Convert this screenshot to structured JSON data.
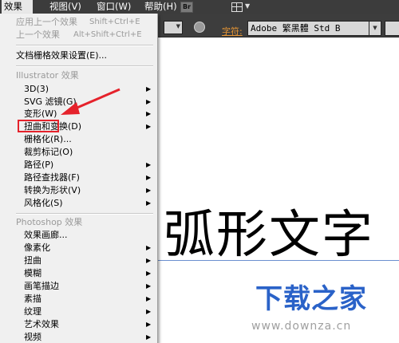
{
  "menubar": {
    "items": [
      {
        "label": "效果(C)",
        "active": true
      },
      {
        "label": "视图(V)"
      },
      {
        "label": "窗口(W)"
      },
      {
        "label": "帮助(H)"
      }
    ],
    "bridge_label": "Br"
  },
  "control_bar": {
    "font_label": "字符:",
    "font_value": "Adobe 繁黑體 Std B"
  },
  "canvas": {
    "text": "弧形文字"
  },
  "watermark": {
    "logo": "下载之家",
    "url": "www.downza.cn"
  },
  "effect_menu": {
    "apply_last": "应用上一个效果",
    "apply_last_shortcut": "Shift+Ctrl+E",
    "last_effect": "上一个效果",
    "last_effect_shortcut": "Alt+Shift+Ctrl+E",
    "doc_raster": "文档栅格效果设置(E)...",
    "illustrator_header": "Illustrator 效果",
    "illustrator_items": [
      "3D(3)",
      "SVG 滤镜(G)",
      "变形(W)",
      "扭曲和变换(D)",
      "栅格化(R)...",
      "裁剪标记(O)",
      "路径(P)",
      "路径查找器(F)",
      "转换为形状(V)",
      "风格化(S)"
    ],
    "photoshop_header": "Photoshop 效果",
    "photoshop_items": [
      "效果画廊...",
      "像素化",
      "扭曲",
      "模糊",
      "画笔描边",
      "素描",
      "纹理",
      "艺术效果",
      "视频"
    ]
  },
  "colors": {
    "highlight": "#e5222b",
    "arrow": "#e5222b",
    "watermark_blue": "#2a62c8",
    "font_label": "#e69534"
  }
}
